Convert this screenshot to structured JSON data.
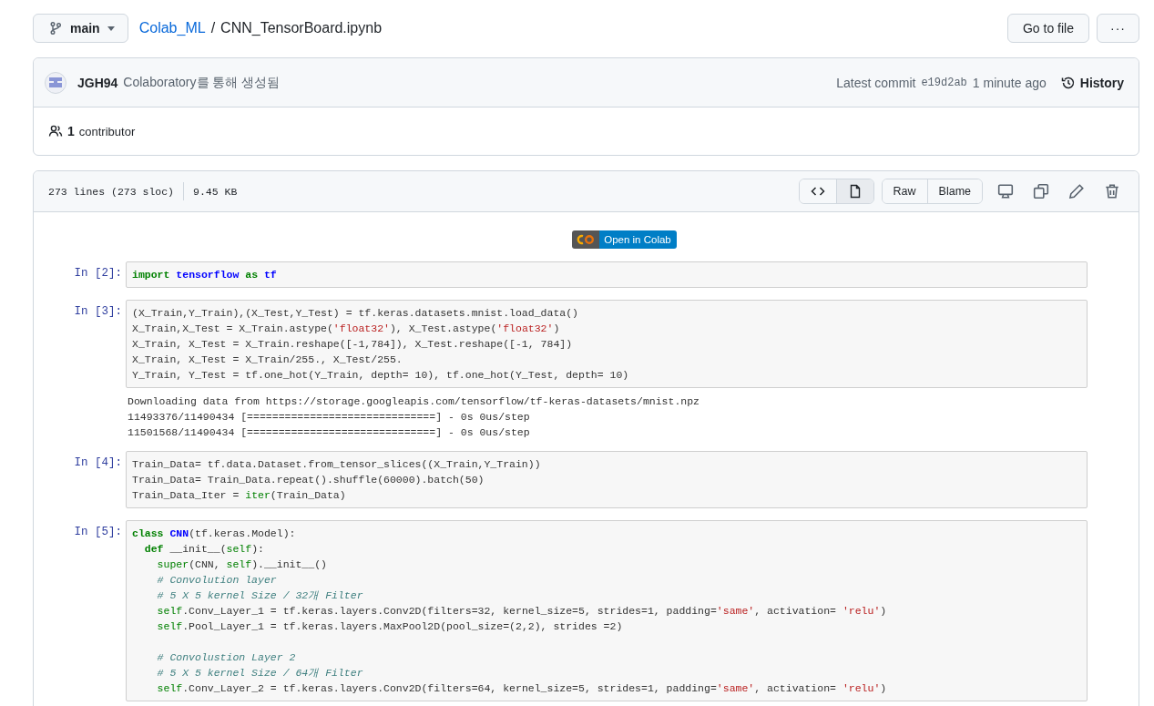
{
  "breadcrumb": {
    "branch": "main",
    "repo": "Colab_ML",
    "separator": "/",
    "file": "CNN_TensorBoard.ipynb"
  },
  "top_actions": {
    "go_to_file": "Go to file",
    "more": "···"
  },
  "commit": {
    "author": "JGH94",
    "message": "Colaboratory를 통해 생성됨",
    "latest_label": "Latest commit",
    "sha": "e19d2ab",
    "time": "1 minute ago",
    "history": "History"
  },
  "contributors": {
    "count": "1",
    "label": "contributor"
  },
  "file_info": {
    "lines": "273 lines (273 sloc)",
    "size": "9.45 KB"
  },
  "view_toggle": [
    {
      "kind": "code",
      "selected": false
    },
    {
      "kind": "preview",
      "selected": true
    }
  ],
  "file_buttons": [
    "Raw",
    "Blame"
  ],
  "badge": {
    "text": "Open in Colab"
  },
  "cells": [
    {
      "prompt": "In [2]:",
      "lines": [
        {
          "kind": "code",
          "tokens": [
            {
              "kind": "kw",
              "text": "import"
            },
            {
              "kind": "name",
              "text": " tensorflow"
            },
            {
              "kind": "kw",
              "text": " as"
            },
            {
              "kind": "name",
              "text": " tf"
            }
          ]
        }
      ]
    },
    {
      "prompt": "In [3]:",
      "lines": [
        {
          "kind": "code",
          "tokens": [
            {
              "kind": "plain",
              "text": "(X_Train,Y_Train),(X_Test,Y_Test) = tf.keras.datasets.mnist.load_data()"
            }
          ]
        },
        {
          "kind": "code",
          "tokens": [
            {
              "kind": "plain",
              "text": "X_Train,X_Test = X_Train.astype("
            },
            {
              "kind": "str",
              "text": "'float32'"
            },
            {
              "kind": "plain",
              "text": "), X_Test.astype("
            },
            {
              "kind": "str",
              "text": "'float32'"
            },
            {
              "kind": "plain",
              "text": ")"
            }
          ]
        },
        {
          "kind": "code",
          "tokens": [
            {
              "kind": "plain",
              "text": "X_Train, X_Test = X_Train.reshape([-1,784]), X_Test.reshape([-1, 784])"
            }
          ]
        },
        {
          "kind": "code",
          "tokens": [
            {
              "kind": "plain",
              "text": "X_Train, X_Test = X_Train/255., X_Test/255."
            }
          ]
        },
        {
          "kind": "code",
          "tokens": [
            {
              "kind": "plain",
              "text": "Y_Train, Y_Test = tf.one_hot(Y_Train, depth= 10), tf.one_hot(Y_Test, depth= 10)"
            }
          ]
        }
      ],
      "output": [
        "Downloading data from https://storage.googleapis.com/tensorflow/tf-keras-datasets/mnist.npz",
        "11493376/11490434 [==============================] - 0s 0us/step",
        "11501568/11490434 [==============================] - 0s 0us/step"
      ]
    },
    {
      "prompt": "In [4]:",
      "lines": [
        {
          "kind": "code",
          "tokens": [
            {
              "kind": "plain",
              "text": "Train_Data= tf.data.Dataset.from_tensor_slices((X_Train,Y_Train))"
            }
          ]
        },
        {
          "kind": "code",
          "tokens": [
            {
              "kind": "plain",
              "text": "Train_Data= Train_Data.repeat().shuffle(60000).batch(50)"
            }
          ]
        },
        {
          "kind": "code",
          "tokens": [
            {
              "kind": "plain",
              "text": "Train_Data_Iter = "
            },
            {
              "kind": "builtin",
              "text": "iter"
            },
            {
              "kind": "plain",
              "text": "(Train_Data)"
            }
          ]
        }
      ]
    },
    {
      "prompt": "In [5]:",
      "lines": [
        {
          "kind": "code",
          "tokens": [
            {
              "kind": "kw",
              "text": "class"
            },
            {
              "kind": "name",
              "text": " CNN"
            },
            {
              "kind": "plain",
              "text": "(tf.keras.Model):"
            }
          ]
        },
        {
          "kind": "code",
          "tokens": [
            {
              "kind": "kw",
              "text": "  def"
            },
            {
              "kind": "plain",
              "text": " __init__("
            },
            {
              "kind": "builtin",
              "text": "self"
            },
            {
              "kind": "plain",
              "text": "):"
            }
          ]
        },
        {
          "kind": "code",
          "tokens": [
            {
              "kind": "builtin",
              "text": "    super"
            },
            {
              "kind": "plain",
              "text": "(CNN, "
            },
            {
              "kind": "builtin",
              "text": "self"
            },
            {
              "kind": "plain",
              "text": ").__init__()"
            }
          ]
        },
        {
          "kind": "code",
          "tokens": [
            {
              "kind": "comment",
              "text": "    # Convolution layer"
            }
          ]
        },
        {
          "kind": "code",
          "tokens": [
            {
              "kind": "comment",
              "text": "    # 5 X 5 kernel Size / 32개 Filter"
            }
          ]
        },
        {
          "kind": "code",
          "tokens": [
            {
              "kind": "builtin",
              "text": "    self"
            },
            {
              "kind": "plain",
              "text": ".Conv_Layer_1 = tf.keras.layers.Conv2D(filters=32, kernel_size=5, strides=1, padding="
            },
            {
              "kind": "str",
              "text": "'same'"
            },
            {
              "kind": "plain",
              "text": ", activation= "
            },
            {
              "kind": "str",
              "text": "'relu'"
            },
            {
              "kind": "plain",
              "text": ")"
            }
          ]
        },
        {
          "kind": "code",
          "tokens": [
            {
              "kind": "builtin",
              "text": "    self"
            },
            {
              "kind": "plain",
              "text": ".Pool_Layer_1 = tf.keras.layers.MaxPool2D(pool_size=(2,2), strides =2)"
            }
          ]
        },
        {
          "kind": "blank"
        },
        {
          "kind": "code",
          "tokens": [
            {
              "kind": "comment",
              "text": "    # Convolustion Layer 2"
            }
          ]
        },
        {
          "kind": "code",
          "tokens": [
            {
              "kind": "comment",
              "text": "    # 5 X 5 kernel Size / 64개 Filter"
            }
          ]
        },
        {
          "kind": "code",
          "tokens": [
            {
              "kind": "builtin",
              "text": "    self"
            },
            {
              "kind": "plain",
              "text": ".Conv_Layer_2 = tf.keras.layers.Conv2D(filters=64, kernel_size=5, strides=1, padding="
            },
            {
              "kind": "str",
              "text": "'same'"
            },
            {
              "kind": "plain",
              "text": ", activation= "
            },
            {
              "kind": "str",
              "text": "'relu'"
            },
            {
              "kind": "plain",
              "text": ")"
            }
          ]
        }
      ]
    }
  ]
}
